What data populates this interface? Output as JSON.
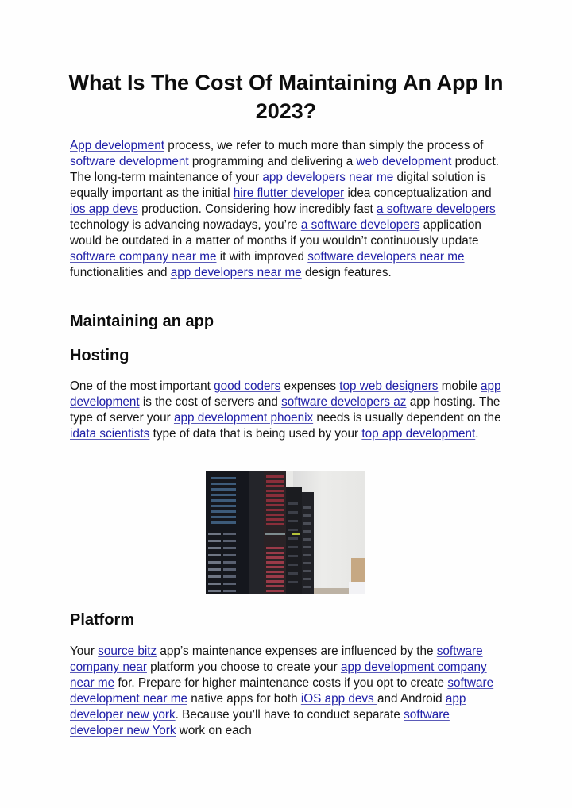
{
  "document": {
    "title": "What Is The Cost Of Maintaining An App In 2023?",
    "intro": [
      {
        "link": "App development"
      },
      {
        "text": " process, we refer to much more than simply the process of "
      },
      {
        "link": "software development"
      },
      {
        "text": " programming and delivering a "
      },
      {
        "link": "web development"
      },
      {
        "text": " product. The long-term maintenance of your "
      },
      {
        "link": "app developers near me"
      },
      {
        "text": " digital solution is equally important as the initial "
      },
      {
        "link": "hire flutter developer"
      },
      {
        "text": " idea conceptualization and "
      },
      {
        "link": "ios app devs"
      },
      {
        "text": " production. Considering how incredibly fast "
      },
      {
        "link": "a software developers"
      },
      {
        "text": " technology is advancing nowadays, you’re "
      },
      {
        "link": "a software developers"
      },
      {
        "text": " application would be outdated in a matter of months if you wouldn’t continuously update "
      },
      {
        "link": "software company near me"
      },
      {
        "text": " it with improved "
      },
      {
        "link": "software developers near me"
      },
      {
        "text": " functionalities and "
      },
      {
        "link": "app developers near me"
      },
      {
        "text": " design features."
      }
    ],
    "heading_maintaining": "Maintaining an app",
    "heading_hosting": "Hosting",
    "hosting_paragraph": [
      {
        "text": "One of the most important "
      },
      {
        "link": "good coders"
      },
      {
        "text": " expenses "
      },
      {
        "link": "top web designers"
      },
      {
        "text": " mobile "
      },
      {
        "link": "app development"
      },
      {
        "text": " is the cost of servers and "
      },
      {
        "link": "software developers az"
      },
      {
        "text": " app hosting. The type of server your "
      },
      {
        "link": "app development phoenix"
      },
      {
        "text": " needs is usually dependent on the "
      },
      {
        "link": "idata scientists"
      },
      {
        "text": " type of data that is being used by your "
      },
      {
        "link": "top app development"
      },
      {
        "text": "."
      }
    ],
    "image": {
      "alt": "server-racks-photo"
    },
    "heading_platform": "Platform",
    "platform_paragraph": [
      {
        "text": "Your "
      },
      {
        "link": "source bitz"
      },
      {
        "text": " app’s maintenance expenses are influenced by the "
      },
      {
        "link": "software company near"
      },
      {
        "text": " platform you choose to create your "
      },
      {
        "link": "app development company near me"
      },
      {
        "text": " for. Prepare for higher maintenance costs if you opt to create "
      },
      {
        "link": "software development near me"
      },
      {
        "text": " native apps for both "
      },
      {
        "link": "iOS app devs "
      },
      {
        "text": "and Android "
      },
      {
        "link": "app developer new york"
      },
      {
        "text": ". Because you’ll have to conduct separate "
      },
      {
        "link": "software developer new York"
      },
      {
        "text": " work on each"
      }
    ]
  },
  "colors": {
    "link": "#2020a8",
    "text": "#141414",
    "background": "#fefefe"
  }
}
